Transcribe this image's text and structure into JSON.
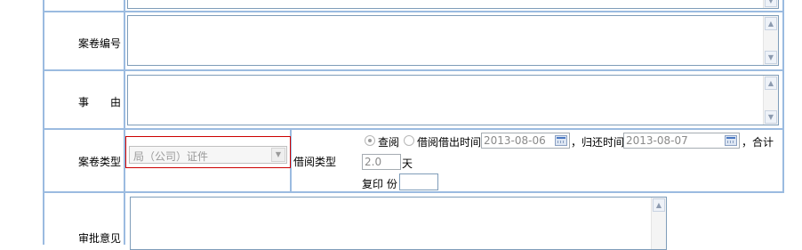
{
  "form": {
    "file_number_label": "案卷编号",
    "reason_label": "事　　由",
    "file_type_label": "案卷类型",
    "file_type_select": {
      "selected": "局（公司）证件"
    },
    "borrow_type_label": "借阅类型",
    "borrow_options": {
      "view": "查阅",
      "borrow": "借阅"
    },
    "borrow_out_time_label": "借出时间",
    "borrow_out_date": "2013-08-06",
    "return_time_label": "，归还时间",
    "return_date": "2013-08-07",
    "total_label": "，合计",
    "total_days": "2.0",
    "days_unit": "天",
    "copy_label": "复印 份",
    "copy_count": "",
    "approval_label": "审批意见"
  },
  "colors": {
    "grid_line": "#9bbbe0",
    "select_highlight": "#cc0000",
    "field_border": "#7f9db9"
  }
}
